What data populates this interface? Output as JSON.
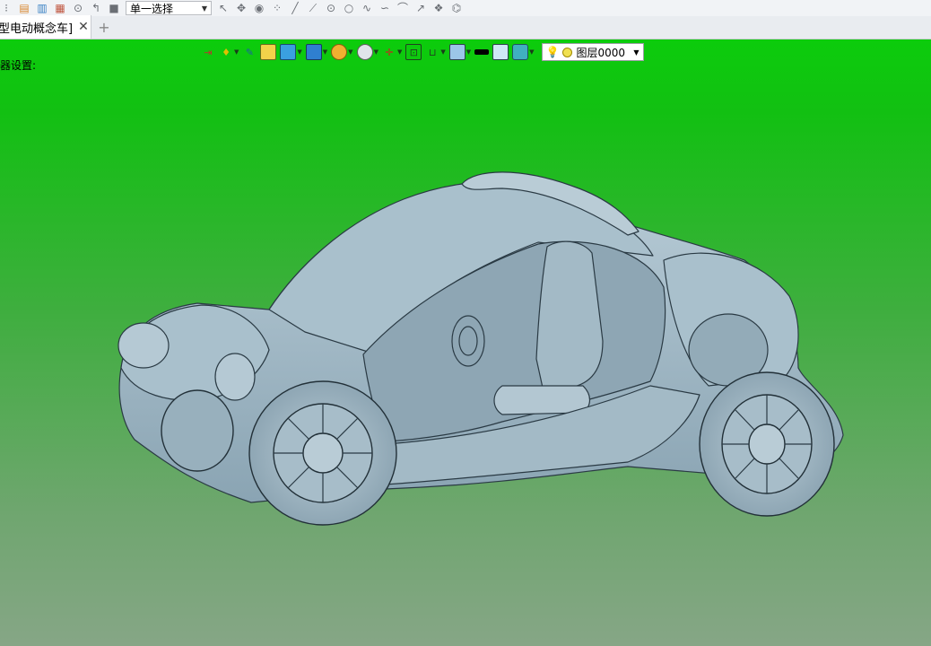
{
  "toolbar": {
    "selection_mode": "单一选择",
    "icons": [
      "new-file-icon",
      "open-file-icon",
      "save-icon",
      "print-icon",
      "undo-icon",
      "redo-icon",
      "stop-icon",
      "pointer-icon",
      "pick-icon",
      "play-icon",
      "points-icon",
      "line-icon",
      "line-tool-icon",
      "point-icon",
      "circle-icon",
      "curve-icon",
      "spline-icon",
      "arc-icon",
      "arrow-icon",
      "feature-icon",
      "measure-icon"
    ]
  },
  "tabs": [
    {
      "label": "型电动概念车]",
      "close": "✕"
    }
  ],
  "new_tab_symbol": "+",
  "viewport": {
    "filter_label": "器设置:",
    "background_top": "#0ccc0c",
    "background_bottom": "#86a686",
    "model_color": "#9fb8c6",
    "view_toolbar_icons": [
      "import-icon",
      "light-icon",
      "pen-icon",
      "box-yellow-icon",
      "cube-icon",
      "view-orient-icon",
      "render-icon",
      "zoom-icon",
      "axis-icon",
      "fit-icon",
      "section-icon",
      "display-icon",
      "color-black-icon",
      "color-light-icon",
      "layer-visibility-icon"
    ],
    "layer": {
      "name": "图层0000"
    }
  }
}
